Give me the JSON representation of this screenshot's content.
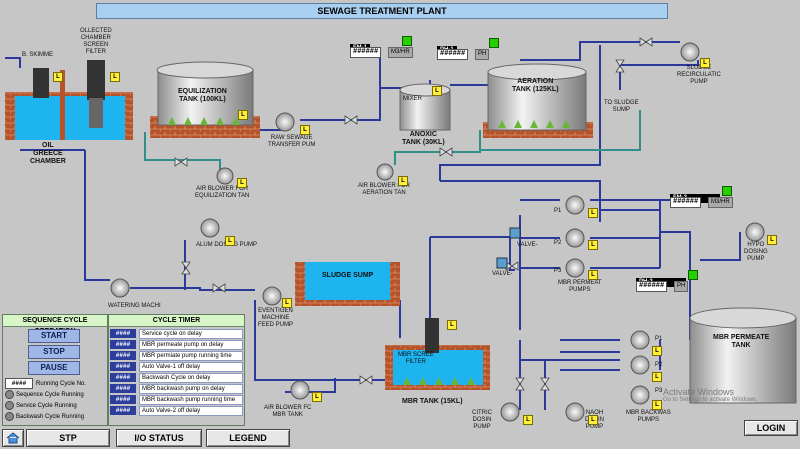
{
  "title": "SEWAGE TREATMENT PLANT",
  "labels": {
    "skimmer": "B. SKIMME",
    "collected": "OLLECTED\nCHAMBER\nSCREEN\nFILTER",
    "oil": "OIL\nGREECE\nCHAMBER",
    "eq": "EQUILIZATION\nTANK (100KL)",
    "raw": "RAW SEWAGE\nTRANSFER PUM",
    "anoxic": "ANOXIC\nTANK (30KL)",
    "mixer": "MIXER",
    "aeration": "AERATION\nTANK (125KL)",
    "sludge_sump_to": "TO SLUDGE\nSUMP",
    "recirc": "SLUDGE\nRECIRCULATIC\nPUMP",
    "airblower1": "AIR BLOWER FOR\nEQUILIZATION TAN",
    "airblower2": "AIR BLOWER FOR\nAERATION TAN",
    "dosing": "ALUM DOSING PUMP",
    "sludge_sump": "SLUDGE SUMP",
    "watering": "WATERING MACHI",
    "even": "EVENTIGEN\nMACHINE\nFEED PUMP",
    "mbr_tank": "MBR TANK (15KL)",
    "mbr_screen": "MBR SCREE\nFILTER",
    "valve1": "VALVE-",
    "valve2": "VALVE-",
    "permeate_pumps": "MBR PERMEAT\nPUMPS",
    "hypo": "HYPO\nDOSING\nPUMP",
    "mbr_perm_tank": "MBR PERMEATE\nTANK",
    "backwash": "MBR BACKWAS\nPUMPS",
    "citric": "CITRIC\nDOSIN\nPUMP",
    "naoh": "NAOH\nDOSIN\nPUMP",
    "airblower3": "AIR BLOWER FC\nMBR TANK"
  },
  "pumps": [
    "P1",
    "P2",
    "P3",
    "P1",
    "P2",
    "P3"
  ],
  "meters": {
    "fm1": {
      "tag": "FM-1",
      "value": "######",
      "unit": "M3/HR"
    },
    "ph1": {
      "tag": "PH-1",
      "value": "######",
      "unit": "PH"
    },
    "fm2": {
      "tag": "FM-2",
      "value": "######",
      "unit": "M3/HR"
    },
    "ph2": {
      "tag": "PH-2",
      "value": "######",
      "unit": "PH"
    }
  },
  "sequence": {
    "title": "SEQUENCE CYCLE OPERATION",
    "start": "START",
    "stop": "STOP",
    "pause": "PAUSE",
    "cycle_no_value": "####",
    "cycle_no_label": "Running Cycle No.",
    "status": [
      "Sequence Cycle Running",
      "Service Cycle Running",
      "Backwash Cycle Running"
    ]
  },
  "timer": {
    "title": "CYCLE TIMER",
    "rows": [
      {
        "value": "####",
        "label": "Service cycle on delay"
      },
      {
        "value": "####",
        "label": "MBR permeate pump on delay"
      },
      {
        "value": "####",
        "label": "MBR permiate pump running time"
      },
      {
        "value": "####",
        "label": "Auto Valve-1 off delay"
      },
      {
        "value": "####",
        "label": "Backwash Cycle on delay"
      },
      {
        "value": "####",
        "label": "MBR backwash pump on delay"
      },
      {
        "value": "####",
        "label": "MBR backwash pump running time"
      },
      {
        "value": "####",
        "label": "Auto Valve-2 off delay"
      }
    ]
  },
  "nav": {
    "stp": "STP",
    "io": "I/O STATUS",
    "legend": "LEGEND",
    "login": "LOGIN"
  },
  "watermark": {
    "line1": "Activate Windows",
    "line2": "Go to Settings to activate Windows."
  },
  "colors": {
    "pipe_blue": "#2b3a9a",
    "pipe_teal": "#2f8f8a",
    "water": "#1eb4f0",
    "brick": "#b8562d",
    "tank": "#c8c8c8"
  }
}
